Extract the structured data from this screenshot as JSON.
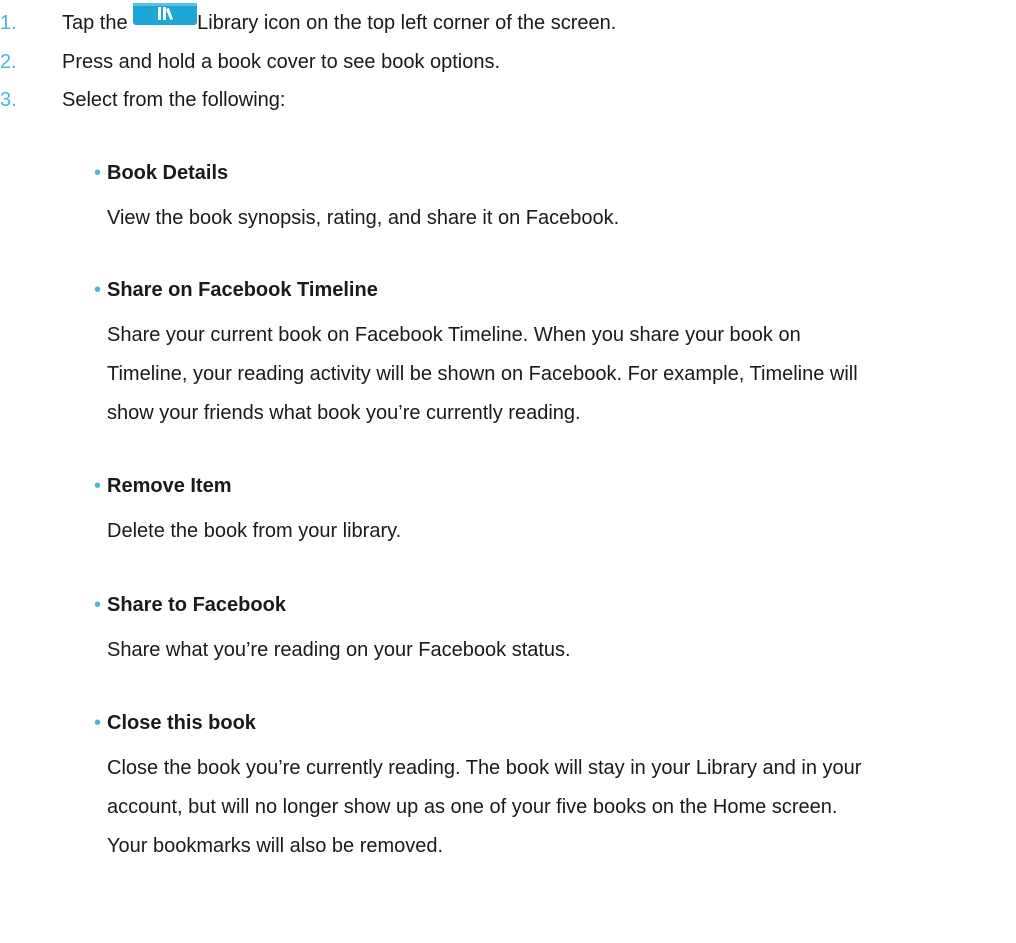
{
  "colors": {
    "accent": "#4ab8d8",
    "text": "#1a1a1a",
    "icon_bg": "#1ea6d4"
  },
  "steps": [
    {
      "num": "1.",
      "before_icon": "Tap the",
      "icon": "library-icon",
      "after_icon": "Library icon on the top left corner of the screen."
    },
    {
      "num": "2.",
      "text": "Press and hold a book cover to see book options."
    },
    {
      "num": "3.",
      "text": "Select from the following:"
    }
  ],
  "options": [
    {
      "bullet": "•",
      "title": "Book Details",
      "lines": [
        "View the book synopsis, rating, and share it on Facebook."
      ]
    },
    {
      "bullet": "•",
      "title": "Share on Facebook Timeline",
      "lines": [
        "Share your current book on Facebook Timeline. When you share your book on",
        "Timeline, your reading activity will be shown on Facebook. For example, Timeline will",
        "show your friends what book you’re currently reading."
      ]
    },
    {
      "bullet": "•",
      "title": "Remove Item",
      "lines": [
        "Delete the book from your library."
      ]
    },
    {
      "bullet": "•",
      "title": "Share to Facebook",
      "lines": [
        "Share what you’re reading on your Facebook status."
      ]
    },
    {
      "bullet": "•",
      "title": "Close this book",
      "lines": [
        "Close the book you’re currently reading. The book will stay in your Library and in your",
        "account, but will no longer show up as one of your five books on the Home screen.",
        "Your bookmarks will also be removed."
      ]
    }
  ]
}
